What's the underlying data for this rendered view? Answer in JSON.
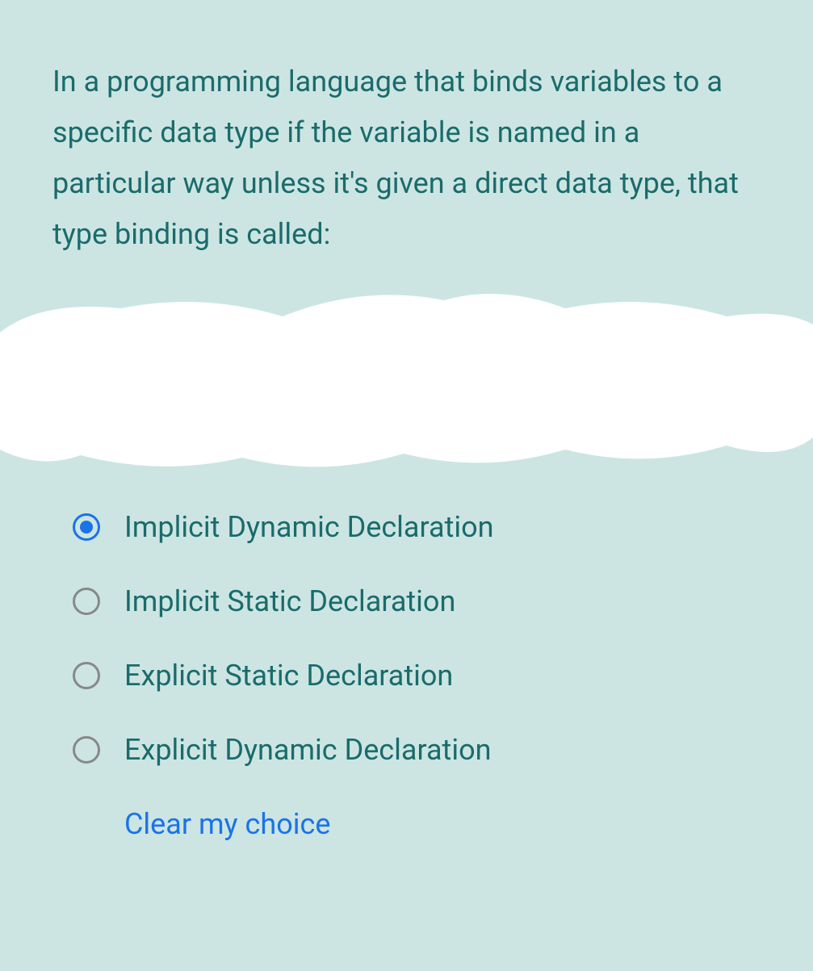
{
  "question": {
    "text": "In a programming language that binds variables to a specific data type if the variable is named in a particular way unless it's given a direct data type, that type binding is called:"
  },
  "options": [
    {
      "label": "Implicit Dynamic Declaration",
      "selected": true
    },
    {
      "label": "Implicit Static Declaration",
      "selected": false
    },
    {
      "label": "Explicit Static Declaration",
      "selected": false
    },
    {
      "label": "Explicit Dynamic Declaration",
      "selected": false
    }
  ],
  "clear_choice_label": "Clear my choice"
}
